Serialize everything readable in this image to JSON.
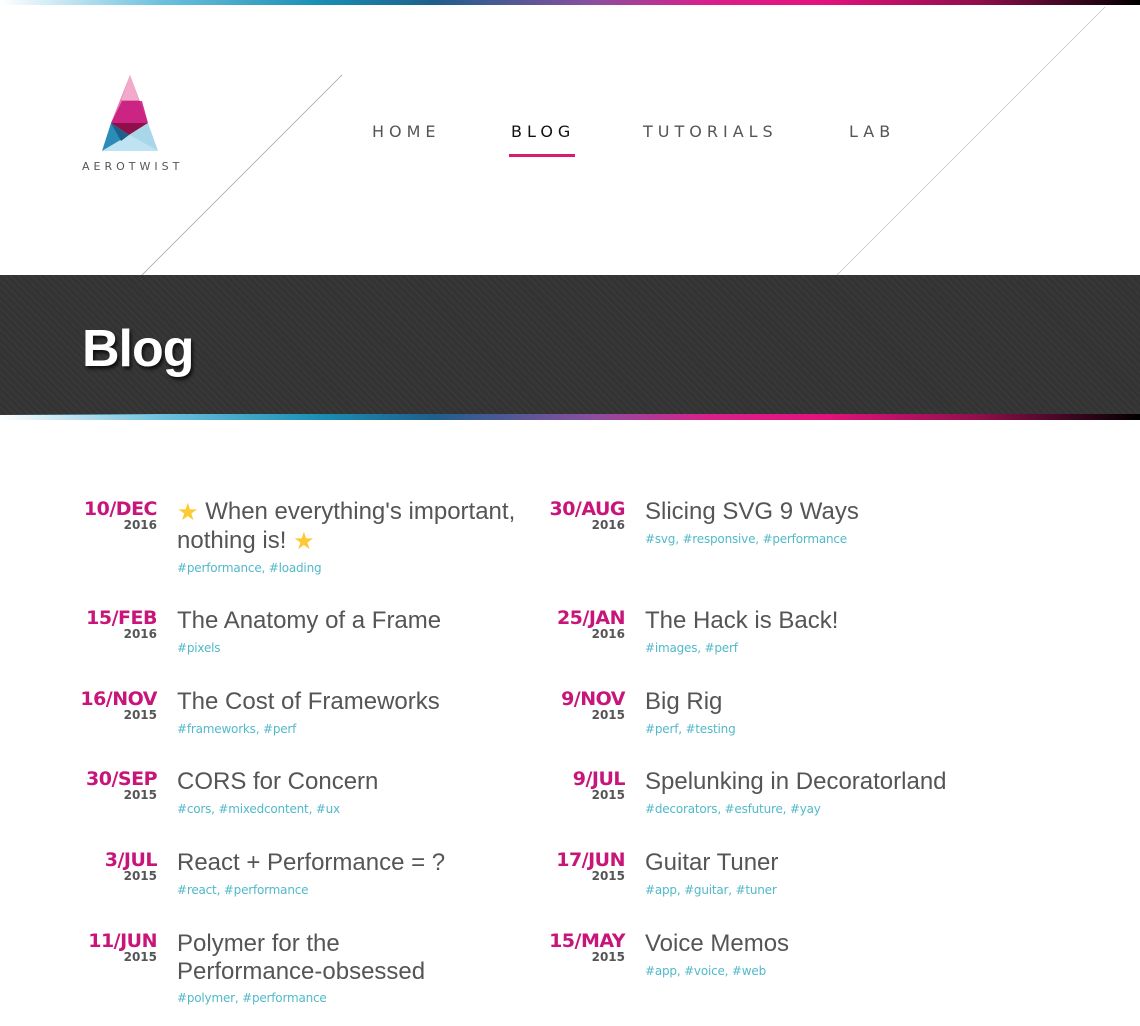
{
  "site": {
    "logo_text": "AEROTWIST",
    "nav": [
      {
        "label": "HOME",
        "active": false
      },
      {
        "label": "BLOG",
        "active": true
      },
      {
        "label": "TUTORIALS",
        "active": false
      },
      {
        "label": "LAB",
        "active": false
      }
    ]
  },
  "hero": {
    "title": "Blog"
  },
  "colors": {
    "accent": "#d81b73",
    "date": "#c8157a",
    "tags": "#52b9c9",
    "hero_bg": "#333333"
  },
  "posts": [
    {
      "day": "10/DEC",
      "year": "2016",
      "title": "When everything's important, nothing is!",
      "star_icon": "star-icon",
      "tags": "#performance, #loading"
    },
    {
      "day": "30/AUG",
      "year": "2016",
      "title": "Slicing SVG 9 Ways",
      "tags": "#svg, #responsive, #performance"
    },
    {
      "day": "15/FEB",
      "year": "2016",
      "title": "The Anatomy of a Frame",
      "tags": "#pixels"
    },
    {
      "day": "25/JAN",
      "year": "2016",
      "title": "The Hack is Back!",
      "tags": "#images, #perf"
    },
    {
      "day": "16/NOV",
      "year": "2015",
      "title": "The Cost of Frameworks",
      "tags": "#frameworks, #perf"
    },
    {
      "day": "9/NOV",
      "year": "2015",
      "title": "Big Rig",
      "tags": "#perf, #testing"
    },
    {
      "day": "30/SEP",
      "year": "2015",
      "title": "CORS for Concern",
      "tags": "#cors, #mixedcontent, #ux"
    },
    {
      "day": "9/JUL",
      "year": "2015",
      "title": "Spelunking in Decoratorland",
      "tags": "#decorators, #esfuture, #yay"
    },
    {
      "day": "3/JUL",
      "year": "2015",
      "title": "React + Performance = ?",
      "tags": "#react, #performance"
    },
    {
      "day": "17/JUN",
      "year": "2015",
      "title": "Guitar Tuner",
      "tags": "#app, #guitar, #tuner"
    },
    {
      "day": "11/JUN",
      "year": "2015",
      "title": "Polymer for the Performance-obsessed",
      "tags": "#polymer, #performance"
    },
    {
      "day": "15/MAY",
      "year": "2015",
      "title": "Voice Memos",
      "tags": "#app, #voice, #web"
    }
  ]
}
